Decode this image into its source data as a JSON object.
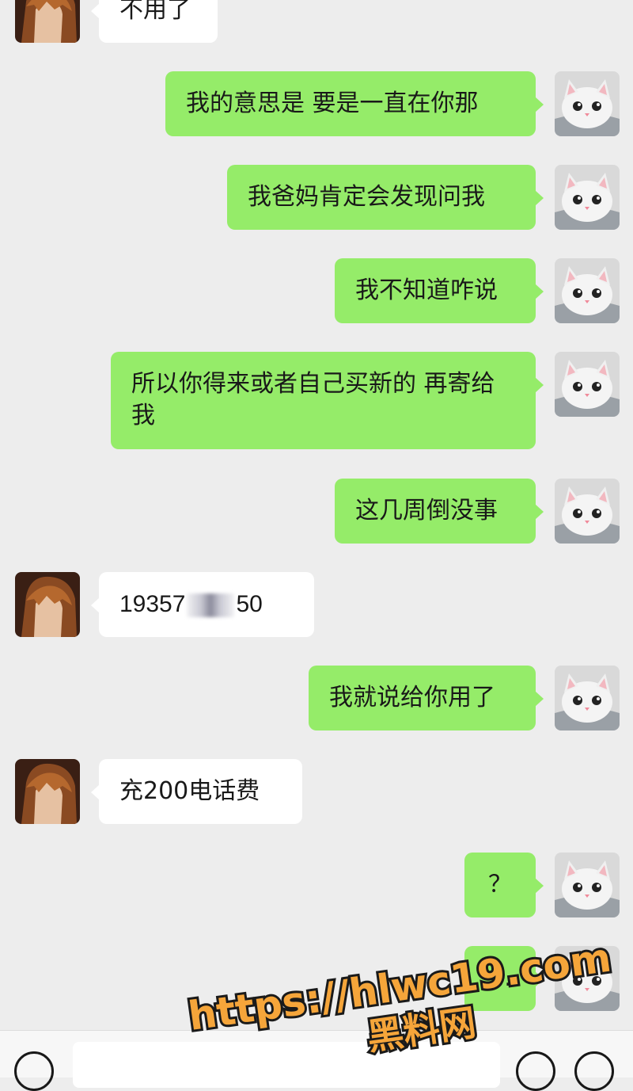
{
  "messages": [
    {
      "side": "them",
      "text": "不用了"
    },
    {
      "side": "me",
      "text": "我的意思是 要是一直在你那"
    },
    {
      "side": "me",
      "text": "我爸妈肯定会发现问我"
    },
    {
      "side": "me",
      "text": "我不知道咋说"
    },
    {
      "side": "me",
      "text": "所以你得来或者自己买新的 再寄给我"
    },
    {
      "side": "me",
      "text": "这几周倒没事"
    },
    {
      "side": "them",
      "text_before": "19357",
      "text_after": "50"
    },
    {
      "side": "me",
      "text": "我就说给你用了"
    },
    {
      "side": "them",
      "text": "充200电话费"
    },
    {
      "side": "me",
      "text": "？"
    },
    {
      "side": "me",
      "text": "…"
    }
  ],
  "watermark": {
    "url": "https://hlwc19.com",
    "site": "黑料网",
    "color": "#f5a53a"
  },
  "colors": {
    "me_bubble": "#95ec69",
    "them_bubble": "#ffffff",
    "background": "#ededed"
  }
}
